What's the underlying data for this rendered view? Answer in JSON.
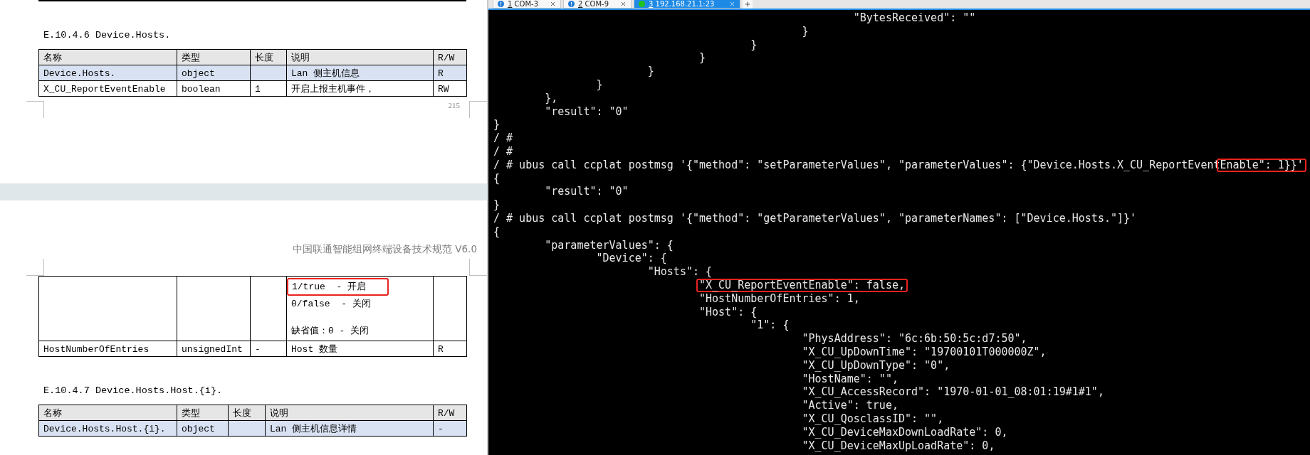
{
  "document": {
    "page_1": {
      "section": {
        "heading": "E.10.4.6 Device.Hosts.",
        "columns": [
          "名称",
          "类型",
          "长度",
          "说明",
          "R/W"
        ],
        "rows": [
          {
            "shaded": true,
            "cells": [
              "Device.Hosts.",
              "object",
              null,
              "Lan 侧主机信息",
              "R"
            ]
          },
          {
            "shaded": false,
            "cells": [
              "X_CU_ReportEventEnable",
              "boolean",
              "1",
              "开启上报主机事件，",
              "RW"
            ]
          }
        ]
      },
      "page_number": "215"
    },
    "page_2": {
      "running_header": "中国联通智能组网终端设备技术规范 V6.0",
      "continued_rows": [
        {
          "shaded": false,
          "cells": [
            null,
            null,
            null,
            [
              [
                {
                  "text": "1/true  - 开启",
                  "boxed": true
                },
                {
                  "text": "0/false  - 关闭",
                  "boxed": false
                }
              ],
              [
                {
                  "text": "缺省值：0 - 关闭",
                  "boxed": false
                }
              ]
            ],
            null
          ]
        },
        {
          "shaded": false,
          "cells": [
            "HostNumberOfEntries",
            "unsignedInt",
            "-",
            "Host 数量",
            "R"
          ]
        }
      ],
      "section": {
        "heading": "E.10.4.7 Device.Hosts.Host.{i}.",
        "columns": [
          "名称",
          "类型",
          "长度",
          "说明",
          "R/W"
        ],
        "rows": [
          {
            "shaded": true,
            "cells": [
              "Device.Hosts.Host.{i}.",
              "object",
              null,
              "Lan 侧主机信息详情",
              "-"
            ]
          }
        ]
      }
    }
  },
  "terminal": {
    "tabs": [
      {
        "number": "1",
        "label": "COM-3",
        "connected": false,
        "selected": false
      },
      {
        "number": "2",
        "label": "COM-9",
        "connected": false,
        "selected": false
      },
      {
        "number": "3",
        "label": "192.168.21.1:23",
        "connected": true,
        "selected": true
      }
    ],
    "lines": [
      {
        "text": "\t\t\t\t\t\t\t\"BytesReceived\": \"\""
      },
      {
        "text": "\t\t\t\t\t\t}"
      },
      {
        "text": "\t\t\t\t\t}"
      },
      {
        "text": "\t\t\t\t}"
      },
      {
        "text": "\t\t\t}"
      },
      {
        "text": "\t\t}"
      },
      {
        "text": "\t},"
      },
      {
        "text": "\t\"result\": \"0\""
      },
      {
        "text": "}"
      },
      {
        "text": "/ #"
      },
      {
        "text": "/ #"
      },
      {
        "parts": [
          {
            "text": "/ # ubus call ccplat postmsg '{\"method\": \"setParameterValues\", \"parameterValues\": {\"Device.Hosts.X_CU_ReportEvent",
            "boxed": false
          },
          {
            "text": "Enable\": 1}}'",
            "boxed": true
          }
        ]
      },
      {
        "text": "{"
      },
      {
        "text": "\t\"result\": \"0\""
      },
      {
        "text": "}"
      },
      {
        "text": "/ # ubus call ccplat postmsg '{\"method\": \"getParameterValues\", \"parameterNames\": [\"Device.Hosts.\"]}'"
      },
      {
        "text": "{"
      },
      {
        "text": "\t\"parameterValues\": {"
      },
      {
        "text": "\t\t\"Device\": {"
      },
      {
        "text": "\t\t\t\"Hosts\": {"
      },
      {
        "parts": [
          {
            "text": "\t\t\t\t\"X_CU_ReportEventEnable\": false,",
            "boxed": true
          }
        ]
      },
      {
        "text": "\t\t\t\t\"HostNumberOfEntries\": 1,"
      },
      {
        "text": "\t\t\t\t\"Host\": {"
      },
      {
        "text": "\t\t\t\t\t\"1\": {"
      },
      {
        "text": "\t\t\t\t\t\t\"PhysAddress\": \"6c:6b:50:5c:d7:50\","
      },
      {
        "text": "\t\t\t\t\t\t\"X_CU_UpDownTime\": \"19700101T000000Z\","
      },
      {
        "text": "\t\t\t\t\t\t\"X_CU_UpDownType\": \"0\","
      },
      {
        "text": "\t\t\t\t\t\t\"HostName\": \"\","
      },
      {
        "text": "\t\t\t\t\t\t\"X_CU_AccessRecord\": \"1970-01-01_08:01:19#1#1\","
      },
      {
        "text": "\t\t\t\t\t\t\"Active\": true,"
      },
      {
        "text": "\t\t\t\t\t\t\"X_CU_QosclassID\": \"\","
      },
      {
        "text": "\t\t\t\t\t\t\"X_CU_DeviceMaxDownLoadRate\": 0,"
      },
      {
        "text": "\t\t\t\t\t\t\"X_CU_DeviceMaxUpLoadRate\": 0,"
      }
    ]
  }
}
